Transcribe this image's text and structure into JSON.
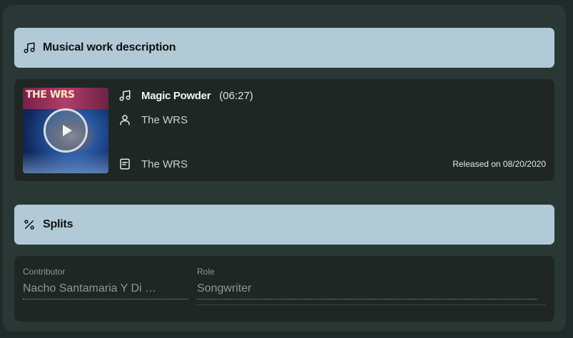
{
  "work_section": {
    "title": "Musical work description",
    "icon": "music-note-icon"
  },
  "work": {
    "cover_text": "THE WRS",
    "title": "Magic Powder",
    "duration": "(06:27)",
    "artist": "The WRS",
    "label": "The WRS",
    "released": "Released on 08/20/2020"
  },
  "splits_section": {
    "title": "Splits",
    "icon": "percent-icon"
  },
  "splits": {
    "contributor_label": "Contributor",
    "contributor_value": "Nacho Santamaria Y Di …",
    "role_label": "Role",
    "role_value": "Songwriter"
  },
  "colors": {
    "background": "#1e2b29",
    "panel": "#2a3835",
    "header": "#b1cad6",
    "card": "#1f2725"
  }
}
